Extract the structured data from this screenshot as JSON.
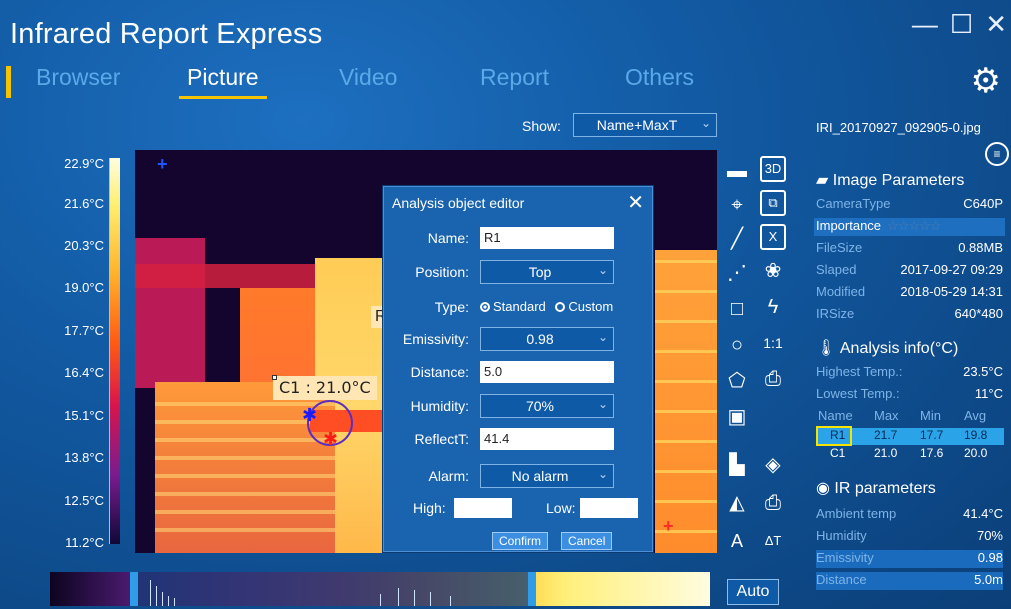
{
  "app": {
    "title": "Infrared Report Express",
    "window_controls": [
      "—",
      "☐",
      "✕"
    ]
  },
  "tabs": [
    {
      "label": "Browser",
      "active": false
    },
    {
      "label": "Picture",
      "active": true
    },
    {
      "label": "Video",
      "active": false
    },
    {
      "label": "Report",
      "active": false
    },
    {
      "label": "Others",
      "active": false
    }
  ],
  "show": {
    "label": "Show:",
    "value": "Name+MaxT"
  },
  "file_name": "IRI_20170927_092905-0.jpg",
  "scale": [
    "22.9°C",
    "21.6°C",
    "20.3°C",
    "19.0°C",
    "17.7°C",
    "16.4°C",
    "15.1°C",
    "13.8°C",
    "12.5°C",
    "11.2°C"
  ],
  "image": {
    "c1_label": "C1 : 21.0°C",
    "r1_label": "R"
  },
  "dialog": {
    "title": "Analysis object editor",
    "close": "✕",
    "name_label": "Name:",
    "name_value": "R1",
    "position_label": "Position:",
    "position_value": "Top",
    "type_label": "Type:",
    "type_standard": "Standard",
    "type_custom": "Custom",
    "emissivity_label": "Emissivity:",
    "emissivity_value": "0.98",
    "distance_label": "Distance:",
    "distance_value": "5.0",
    "humidity_label": "Humidity:",
    "humidity_value": "70%",
    "reflect_label": "ReflectT:",
    "reflect_value": "41.4",
    "alarm_label": "Alarm:",
    "alarm_value": "No alarm",
    "high_label": "High:",
    "low_label": "Low:",
    "confirm": "Confirm",
    "cancel": "Cancel"
  },
  "auto_button": "Auto",
  "panel": {
    "image_params_title": "Image Parameters",
    "camera_type_k": "CameraType",
    "camera_type_v": "C640P",
    "importance_k": "Importance",
    "file_size_k": "FileSize",
    "file_size_v": "0.88MB",
    "slaped_k": "Slaped",
    "slaped_v": "2017-09-27 09:29",
    "modified_k": "Modified",
    "modified_v": "2018-05-29 14:31",
    "irsize_k": "IRSize",
    "irsize_v": "640*480",
    "analysis_title": "Analysis info(°C)",
    "highest_k": "Highest Temp.:",
    "highest_v": "23.5°C",
    "lowest_k": "Lowest Temp.:",
    "lowest_v": "11°C",
    "table_head": [
      "Name",
      "Max",
      "Min",
      "Avg"
    ],
    "table_rows": [
      [
        "R1",
        "21.7",
        "17.7",
        "19.8"
      ],
      [
        "C1",
        "21.0",
        "17.6",
        "20.0"
      ]
    ],
    "ir_title": "IR parameters",
    "ambient_k": "Ambient temp",
    "ambient_v": "41.4°C",
    "humidity_k": "Humidity",
    "humidity_v": "70%",
    "emissivity_k": "Emissivity",
    "emissivity_v": "0.98",
    "distance_k": "Distance",
    "distance_v": "5.0m"
  },
  "tools": {
    "boxed_3d": "3D",
    "boxed_x": "X",
    "scale_1to1": "1:1",
    "text_a": "A",
    "delta_t": "ΔT"
  },
  "colors": {
    "accent": "#f5c400",
    "background": "#125aa3",
    "inactive_tab": "#5aa9e8",
    "selected_row": "#2aa3e8"
  }
}
